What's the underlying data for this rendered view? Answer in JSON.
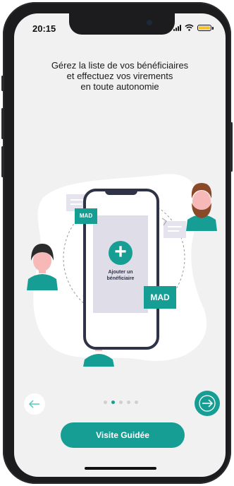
{
  "status_bar": {
    "time": "20:15"
  },
  "headline": {
    "line1": "Gérez la liste de vos bénéficiaires",
    "line2": "et effectuez vos virements",
    "line3": "en toute autonomie"
  },
  "illustration": {
    "badge_small": "MAD",
    "badge_large": "MAD",
    "add_beneficiary_line1": "Ajouter un",
    "add_beneficiary_line2": "bénéficiaire",
    "plus_symbol": "+"
  },
  "pager": {
    "total": 5,
    "active_index": 1
  },
  "nav": {
    "prev_icon": "arrow-left-icon",
    "next_icon": "arrow-right-icon"
  },
  "cta": {
    "label": "Visite Guidée"
  },
  "colors": {
    "accent": "#169e95",
    "accent_light": "#55c7bf",
    "background": "#f1f1f1"
  }
}
